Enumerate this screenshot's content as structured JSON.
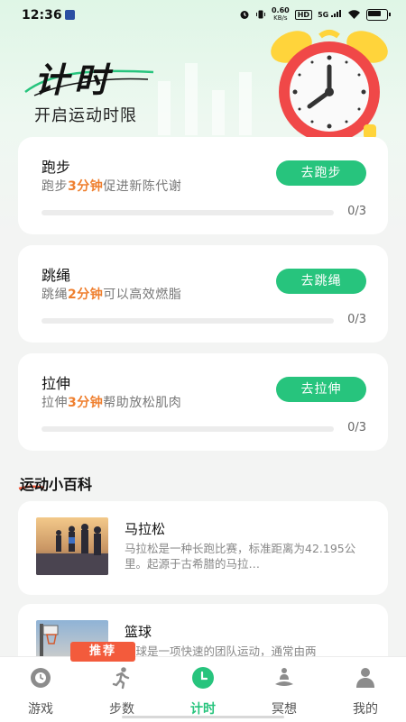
{
  "status_bar": {
    "time": "12:36",
    "net_speed_value": "0.60",
    "net_speed_unit": "KB/s",
    "hd_label": "HD",
    "signal_label": "5G"
  },
  "hero": {
    "title": "计时",
    "subtitle": "开启运动时限"
  },
  "timer_cards": [
    {
      "title": "跑步",
      "desc_prefix": "跑步",
      "desc_highlight": "3分钟",
      "desc_suffix": "促进新陈代谢",
      "button": "去跑步",
      "progress": 0,
      "count": "0/3"
    },
    {
      "title": "跳绳",
      "desc_prefix": "跳绳",
      "desc_highlight": "2分钟",
      "desc_suffix": "可以高效燃脂",
      "button": "去跳绳",
      "progress": 0,
      "count": "0/3"
    },
    {
      "title": "拉伸",
      "desc_prefix": "拉伸",
      "desc_highlight": "3分钟",
      "desc_suffix": "帮助放松肌肉",
      "button": "去拉伸",
      "progress": 0,
      "count": "0/3"
    }
  ],
  "encyclopedia": {
    "section_title": "运动小百科",
    "items": [
      {
        "title": "马拉松",
        "desc": "马拉松是一种长跑比赛，标准距离为42.195公里。起源于古希腊的马拉…"
      },
      {
        "title": "篮球",
        "desc": "篮球是一项快速的团队运动，通常由两"
      }
    ]
  },
  "recommend_tag": "推荐",
  "tabs": [
    {
      "label": "游戏",
      "icon": "controller-icon",
      "active": false
    },
    {
      "label": "步数",
      "icon": "runner-icon",
      "active": false
    },
    {
      "label": "计时",
      "icon": "clock-icon",
      "active": true
    },
    {
      "label": "冥想",
      "icon": "meditation-icon",
      "active": false
    },
    {
      "label": "我的",
      "icon": "person-icon",
      "active": false
    }
  ],
  "colors": {
    "accent": "#27c47d",
    "highlight": "#ef7f2e",
    "recommend": "#f35b3c"
  }
}
